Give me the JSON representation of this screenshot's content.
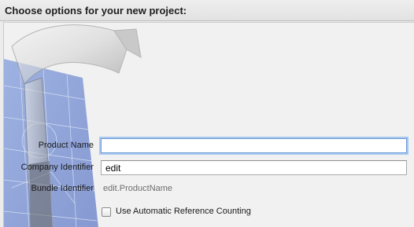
{
  "header": {
    "title": "Choose options for your new project:"
  },
  "form": {
    "product_name": {
      "label": "Product Name",
      "value": ""
    },
    "company_identifier": {
      "label": "Company Identifier",
      "value": "edit"
    },
    "bundle_identifier": {
      "label": "Bundle Identifier",
      "value": "edit.ProductName"
    },
    "arc": {
      "label": "Use Automatic Reference Counting",
      "checked": false
    }
  },
  "icons": {
    "background_art": "xcode-hammer-blueprint-icon"
  },
  "colors": {
    "focus_ring": "#a9c8f0",
    "blueprint": "#3d62c6"
  }
}
